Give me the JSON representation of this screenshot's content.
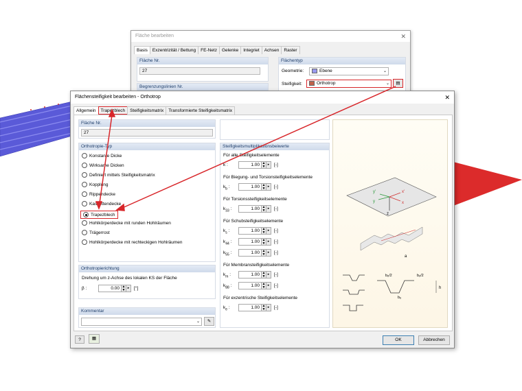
{
  "bg_dialog": {
    "title": "Fläche bearbeiten",
    "tabs": [
      "Basis",
      "Exzentrizität / Bettung",
      "FE-Netz",
      "Gelenke",
      "Integriet",
      "Achsen",
      "Raster"
    ],
    "flaeche_nr_label": "Fläche Nr.",
    "flaeche_nr": "27",
    "begrenzung_label": "Begrenzungslinien Nr.",
    "flaechentyp_label": "Flächentyp",
    "geometrie_label": "Geometrie:",
    "geometrie_value": "Ebene",
    "geometrie_color": "#9999ee",
    "steifigkeit_label": "Steifigkeit:",
    "steifigkeit_value": "Orthotrop",
    "steifigkeit_color": "#c0604a"
  },
  "dialog": {
    "title": "Flächensteifigkeit bearbeiten - Orthotrop",
    "tabs": [
      "Allgemein",
      "Trapezblech",
      "Steifigkeitsmatrix",
      "Transformierte Steifigkeitsmatrix"
    ],
    "flaeche_nr_label": "Fläche Nr.",
    "flaeche_nr": "27",
    "orthotropie_label": "Orthotropie-Typ",
    "types": [
      "Konstante Dicke",
      "Wirksame Dicken",
      "Definiert mittels Steifigkeitsmatrix",
      "Kopplung",
      "Rippendecke",
      "Kassettendecke",
      "Trapezblech",
      "Hohlkörperdecke mit runden Hohlräumen",
      "Trägerrost",
      "Hohlkörperdecke mit rechteckigen Hohlräumen"
    ],
    "selected_type": "Trapezblech",
    "richtung_label": "Orthotropierichtung",
    "drehung_label": "Drehung um z-Achse des lokalen KS der Fläche",
    "beta_label": "β :",
    "beta_value": "0.00",
    "beta_unit": "[°]",
    "kommentar_label": "Kommentar",
    "mult_label": "Steifigkeitsmultiplikationsbeiwerte",
    "mult_groups": [
      {
        "title": "Für alle Steifigkeitselemente",
        "rows": [
          {
            "k": "k",
            "s": "",
            "v": "1.00"
          }
        ]
      },
      {
        "title": "Für Biegung- und Torsionsteifigkeitselemente",
        "rows": [
          {
            "k": "k",
            "s": "b",
            "v": "1.00"
          }
        ]
      },
      {
        "title": "Für Torsionssteifigkeitselemente",
        "rows": [
          {
            "k": "k",
            "s": "33",
            "v": "1.00"
          }
        ]
      },
      {
        "title": "Für Schubsteifigkeitselemente",
        "rows": [
          {
            "k": "k",
            "s": "s",
            "v": "1.00"
          },
          {
            "k": "k",
            "s": "44",
            "v": "1.00"
          },
          {
            "k": "k",
            "s": "55",
            "v": "1.00"
          }
        ]
      },
      {
        "title": "Für Membransteifigkeitselemente",
        "rows": [
          {
            "k": "k",
            "s": "m",
            "v": "1.00"
          },
          {
            "k": "k",
            "s": "88",
            "v": "1.00"
          }
        ]
      },
      {
        "title": "Für exzentrische Steifigkeitselemente",
        "rows": [
          {
            "k": "k",
            "s": "e",
            "v": "1.00"
          }
        ]
      }
    ],
    "unit": "[-]",
    "ok": "OK",
    "cancel": "Abbrechen",
    "tab_highlight": "#d8262a"
  }
}
